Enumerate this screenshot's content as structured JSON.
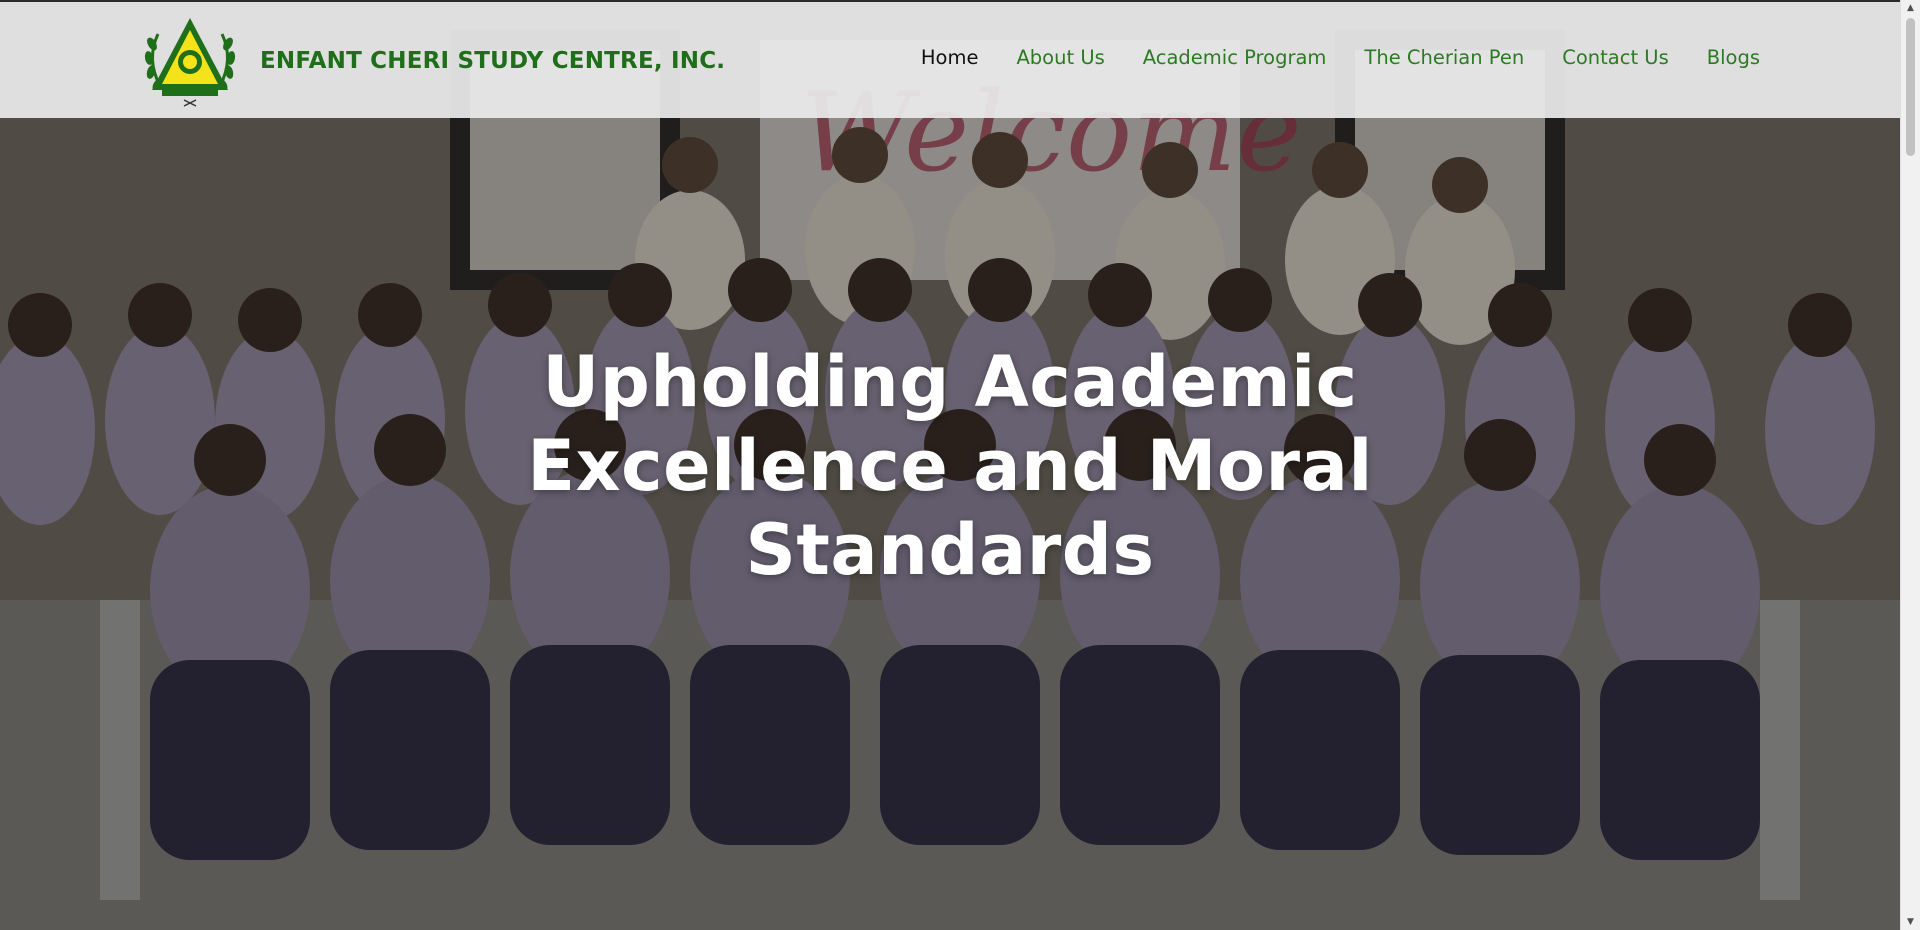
{
  "header": {
    "brand_name": "ENFANT CHERI STUDY CENTRE, INC.",
    "logo_icon": "school-seal-icon"
  },
  "nav": {
    "items": [
      {
        "label": "Home",
        "active": true
      },
      {
        "label": "About Us",
        "active": false
      },
      {
        "label": "Academic Program",
        "active": false
      },
      {
        "label": "The Cherian Pen",
        "active": false
      },
      {
        "label": "Contact Us",
        "active": false
      },
      {
        "label": "Blogs",
        "active": false
      }
    ]
  },
  "hero": {
    "title_lines": [
      "Upholding Academic",
      "Excellence and Moral",
      "Standards"
    ],
    "background": "group-photo-of-faculty"
  },
  "colors": {
    "brand_green": "#1f6e1a",
    "nav_green": "#2d7a24",
    "nav_active": "#111111",
    "header_bg": "#ebebeb",
    "hero_text": "#ffffff"
  }
}
